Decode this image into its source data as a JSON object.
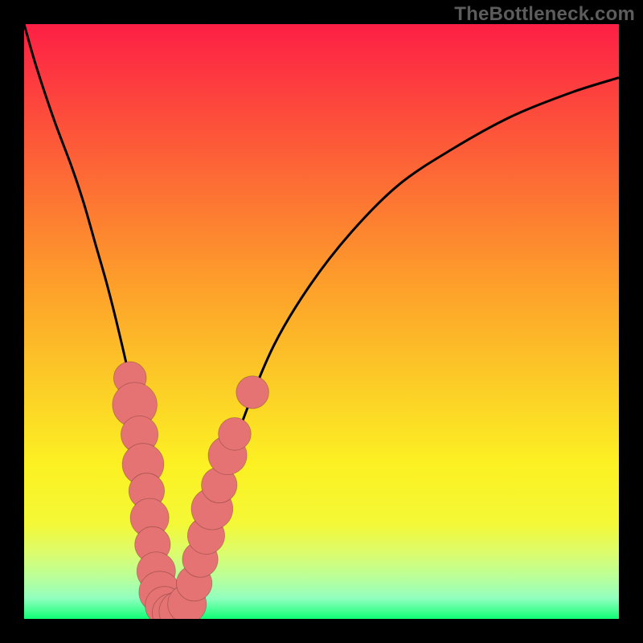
{
  "watermark": "TheBottleneck.com",
  "colors": {
    "red": "#fd1f45",
    "orange": "#fd9a2b",
    "yellow": "#fcf123",
    "lt1": "#f4f836",
    "lt2": "#dbfc6e",
    "lt3": "#baff9a",
    "lt4": "#92ffbf",
    "green": "#10ff75",
    "marker": "#e57373",
    "curve": "#000000",
    "frame": "#000000"
  },
  "chart_data": {
    "type": "line",
    "title": "",
    "xlabel": "",
    "ylabel": "",
    "xlim": [
      0,
      100
    ],
    "ylim": [
      0,
      100
    ],
    "series": [
      {
        "name": "bottleneck-curve",
        "x": [
          0,
          2,
          5,
          8,
          10,
          12,
          14,
          16,
          18,
          20,
          21.5,
          23,
          25,
          27.5,
          30,
          33,
          37,
          42,
          48,
          55,
          63,
          72,
          82,
          92,
          100
        ],
        "values": [
          100,
          93,
          84,
          76,
          70,
          63,
          56,
          48,
          39,
          27,
          15,
          3,
          1,
          3,
          11,
          22,
          34,
          46,
          56,
          65,
          73,
          79,
          84.5,
          88.5,
          91
        ]
      },
      {
        "name": "highlighted-points",
        "type": "scatter",
        "points": [
          {
            "x": 17.8,
            "y": 40.5,
            "r": 2.2
          },
          {
            "x": 18.6,
            "y": 36.0,
            "r": 3.0
          },
          {
            "x": 19.4,
            "y": 31.0,
            "r": 2.5
          },
          {
            "x": 20.0,
            "y": 26.0,
            "r": 2.8
          },
          {
            "x": 20.6,
            "y": 21.5,
            "r": 2.4
          },
          {
            "x": 21.1,
            "y": 17.0,
            "r": 2.6
          },
          {
            "x": 21.6,
            "y": 12.5,
            "r": 2.4
          },
          {
            "x": 22.2,
            "y": 8.0,
            "r": 2.6
          },
          {
            "x": 22.8,
            "y": 4.5,
            "r": 2.8
          },
          {
            "x": 23.6,
            "y": 2.2,
            "r": 2.6
          },
          {
            "x": 24.8,
            "y": 1.0,
            "r": 2.6
          },
          {
            "x": 26.2,
            "y": 1.2,
            "r": 2.8
          },
          {
            "x": 27.4,
            "y": 2.5,
            "r": 2.6
          },
          {
            "x": 28.6,
            "y": 6.0,
            "r": 2.4
          },
          {
            "x": 29.6,
            "y": 10.0,
            "r": 2.4
          },
          {
            "x": 30.6,
            "y": 14.0,
            "r": 2.5
          },
          {
            "x": 31.6,
            "y": 18.5,
            "r": 2.8
          },
          {
            "x": 32.8,
            "y": 22.5,
            "r": 2.4
          },
          {
            "x": 34.2,
            "y": 27.5,
            "r": 2.6
          },
          {
            "x": 35.4,
            "y": 31.1,
            "r": 2.2
          },
          {
            "x": 38.4,
            "y": 38.1,
            "r": 2.2
          }
        ]
      }
    ],
    "gradient_stops": [
      {
        "offset": 0.0,
        "color": "#fd1f45"
      },
      {
        "offset": 0.42,
        "color": "#fd9a2b"
      },
      {
        "offset": 0.74,
        "color": "#fcf123"
      },
      {
        "offset": 0.84,
        "color": "#f4f836"
      },
      {
        "offset": 0.89,
        "color": "#dbfc6e"
      },
      {
        "offset": 0.93,
        "color": "#baff9a"
      },
      {
        "offset": 0.965,
        "color": "#92ffbf"
      },
      {
        "offset": 1.0,
        "color": "#10ff75"
      }
    ]
  }
}
